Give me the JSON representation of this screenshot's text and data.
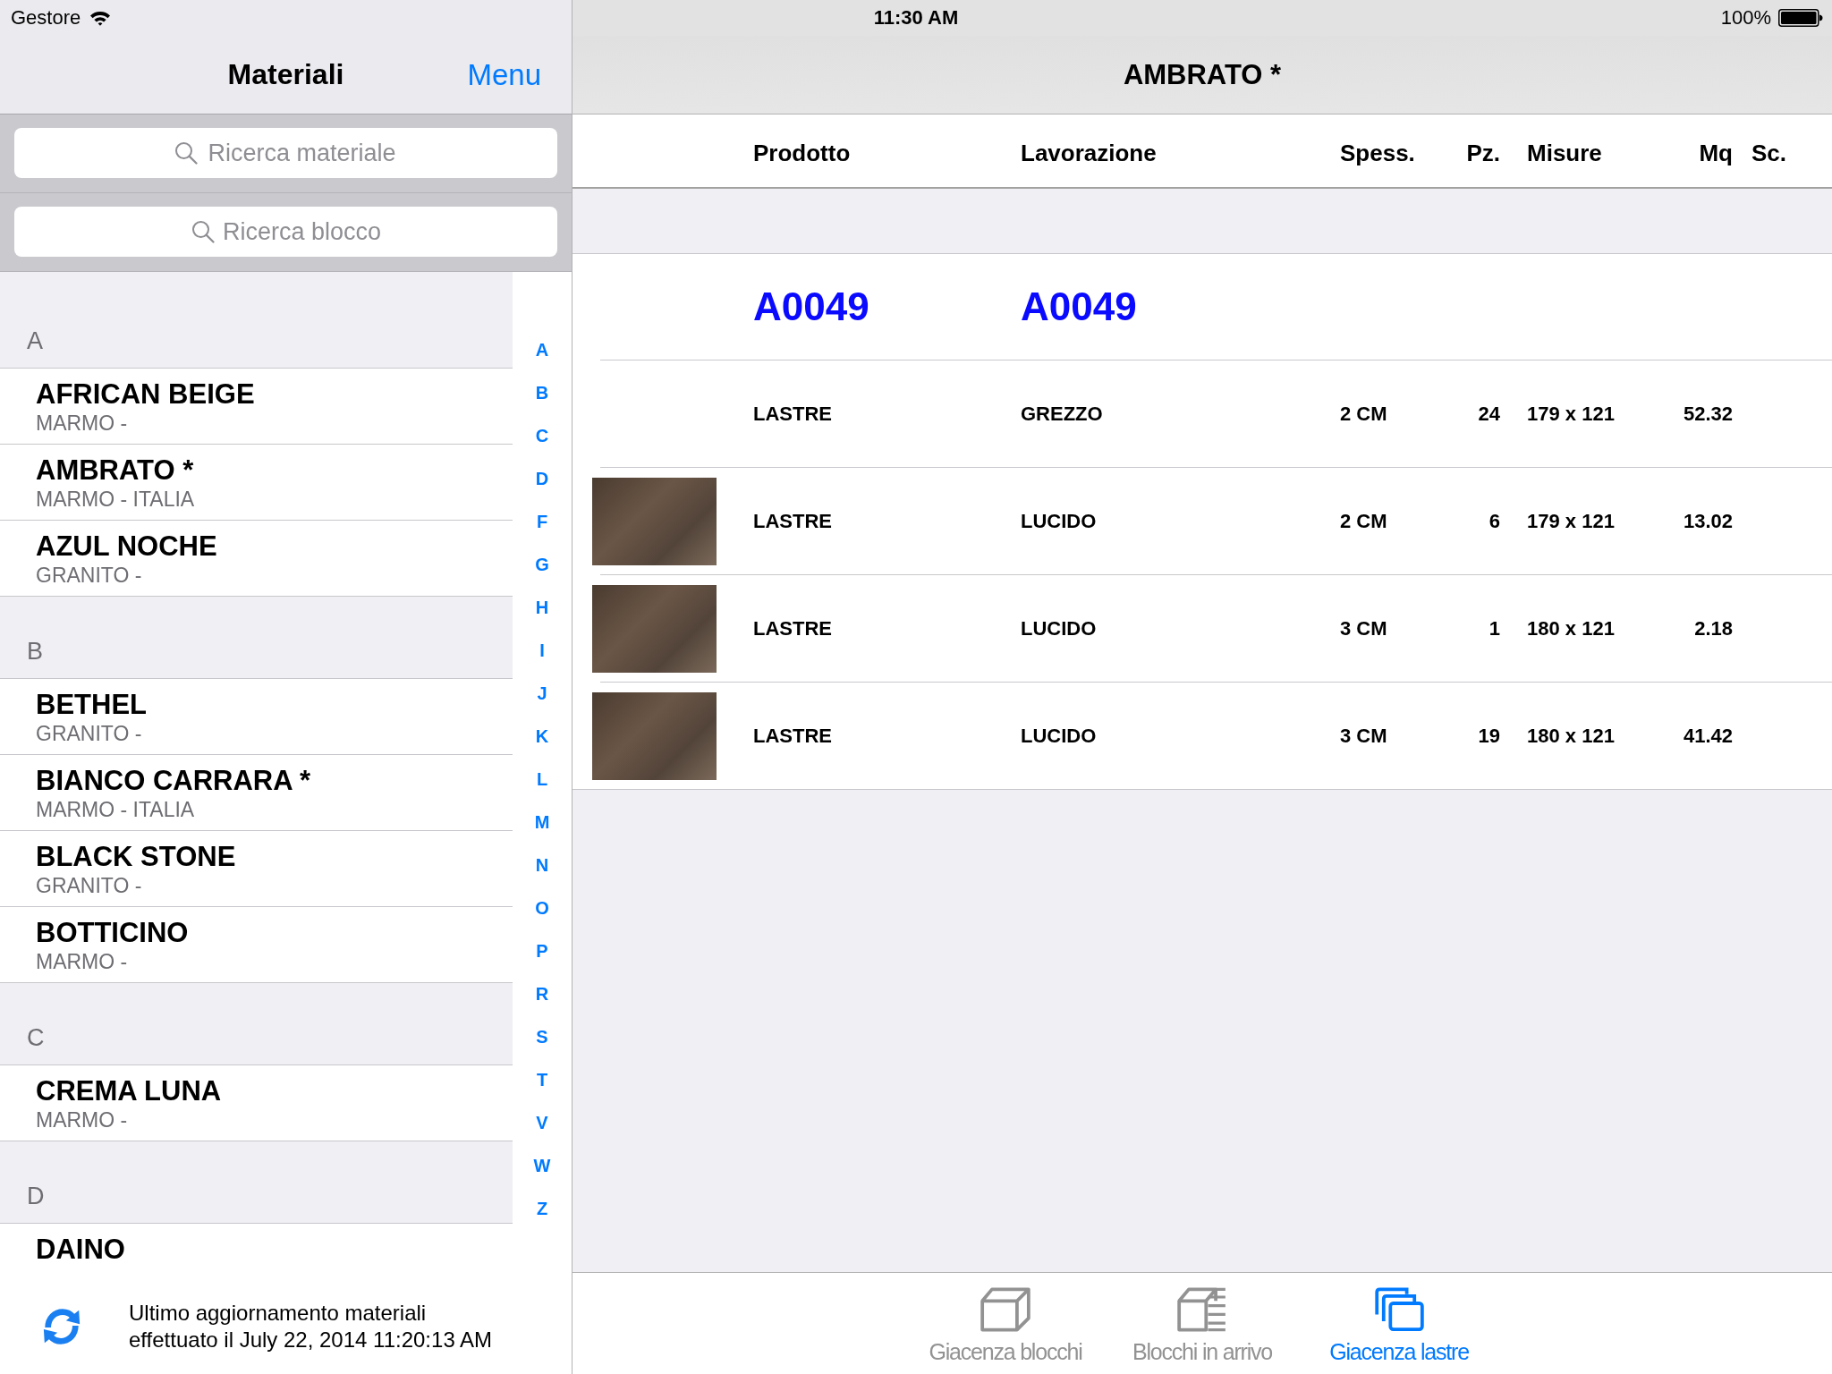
{
  "status_bar": {
    "carrier": "Gestore",
    "time": "11:30 AM",
    "battery": "100%"
  },
  "sidebar": {
    "title": "Materiali",
    "menu_button": "Menu",
    "search_fields": [
      {
        "placeholder": "Ricerca materiale"
      },
      {
        "placeholder": "Ricerca blocco"
      }
    ],
    "sections": [
      {
        "letter": "A",
        "items": [
          {
            "name": "AFRICAN BEIGE",
            "detail": "MARMO -"
          },
          {
            "name": "AMBRATO *",
            "detail": "MARMO - ITALIA"
          },
          {
            "name": "AZUL NOCHE",
            "detail": "GRANITO -"
          }
        ]
      },
      {
        "letter": "B",
        "items": [
          {
            "name": "BETHEL",
            "detail": "GRANITO -"
          },
          {
            "name": "BIANCO CARRARA *",
            "detail": "MARMO - ITALIA"
          },
          {
            "name": "BLACK STONE",
            "detail": "GRANITO -"
          },
          {
            "name": "BOTTICINO",
            "detail": "MARMO -"
          }
        ]
      },
      {
        "letter": "C",
        "items": [
          {
            "name": "CREMA LUNA",
            "detail": "MARMO -"
          }
        ]
      },
      {
        "letter": "D",
        "items": [
          {
            "name": "DAINO"
          }
        ]
      }
    ],
    "index_letters": [
      "A",
      "B",
      "C",
      "D",
      "F",
      "G",
      "H",
      "I",
      "J",
      "K",
      "L",
      "M",
      "N",
      "O",
      "P",
      "R",
      "S",
      "T",
      "V",
      "W",
      "Z"
    ],
    "footer": {
      "text": "Ultimo aggiornamento materiali\neffettuato il July 22, 2014 11:20:13 AM"
    }
  },
  "detail": {
    "title": "AMBRATO *",
    "table": {
      "columns": [
        "Prodotto",
        "Lavorazione",
        "Spess.",
        "Pz.",
        "Misure",
        "Mq",
        "Sc."
      ],
      "groups": [
        {
          "product": "A0049",
          "processing": "A0049",
          "rows": [
            {
              "photo": false,
              "product": "LASTRE",
              "finish": "GREZZO",
              "thickness": "2 CM",
              "pieces": "24",
              "size": "179 x 121",
              "area": "52.32"
            },
            {
              "photo": true,
              "product": "LASTRE",
              "finish": "LUCIDO",
              "thickness": "2 CM",
              "pieces": "6",
              "size": "179 x 121",
              "area": "13.02"
            },
            {
              "photo": true,
              "product": "LASTRE",
              "finish": "LUCIDO",
              "thickness": "3 CM",
              "pieces": "1",
              "size": "180 x 121",
              "area": "2.18"
            },
            {
              "photo": true,
              "product": "LASTRE",
              "finish": "LUCIDO",
              "thickness": "3 CM",
              "pieces": "19",
              "size": "180 x 121",
              "area": "41.42"
            }
          ]
        }
      ]
    }
  },
  "tab_bar": [
    {
      "label": "Giacenza blocchi",
      "selected": false
    },
    {
      "label": "Blocchi in arrivo",
      "selected": false
    },
    {
      "label": "Giacenza lastre",
      "selected": true
    }
  ]
}
